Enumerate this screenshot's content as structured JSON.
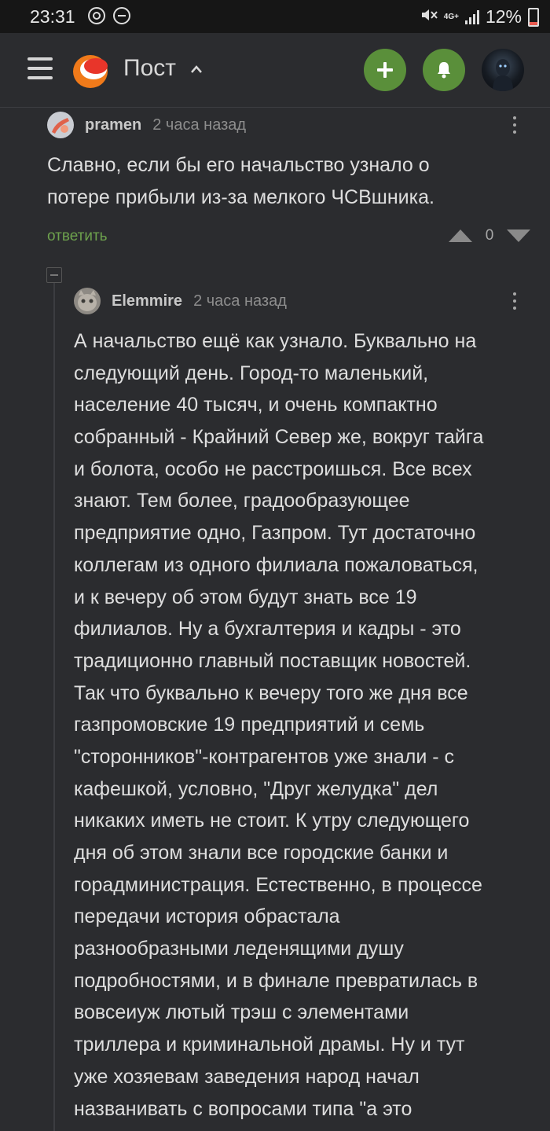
{
  "status_bar": {
    "time": "23:31",
    "network": "4G+",
    "battery": "12%"
  },
  "header": {
    "title": "Пост",
    "colors": {
      "accent_green": "#5a8f3a",
      "logo_orange": "#f07a1a"
    },
    "icons": [
      "menu-icon",
      "pikabu-logo",
      "chevron-up-icon",
      "plus-icon",
      "bell-icon",
      "user-avatar"
    ]
  },
  "comments": [
    {
      "user": "pramen",
      "time": "2 часа назад",
      "text_lines": [
        "Славно, если бы его начальство узнало о",
        "потере прибыли из-за мелкого ЧСВшника."
      ],
      "reply_label": "ответить",
      "rating": "0"
    },
    {
      "user": "Elemmire",
      "time": "2 часа назад",
      "text_lines": [
        "А начальство ещё как узнало. Буквально на",
        "следующий день. Город-то маленький,",
        "население 40 тысяч, и очень компактно",
        "собранный - Крайний Север же, вокруг тайга",
        "и болота, особо не расстроишься. Все всех",
        "знают. Тем более, градообразующее",
        "предприятие одно, Газпром. Тут достаточно",
        "коллегам из одного филиала пожаловаться,",
        "и к вечеру об этом будут знать все 19",
        "филиалов. Ну а бухгалтерия и кадры - это",
        "традиционно главный поставщик новостей.",
        "Так что буквально к вечеру того же дня все",
        "газпромовские 19 предприятий и семь",
        "\"сторонников\"-контрагентов уже знали - с",
        "кафешкой, условно, \"Друг желудка\" дел",
        "никаких иметь не стоит. К утру следующего",
        "дня об этом знали все городские банки и",
        "горадминистрация. Естественно, в процессе",
        "передачи история обрастала",
        "разнообразными леденящими душу",
        "подробностями, и в финале превратилась в",
        "вовсеиуж лютый трэш с элементами",
        "триллера и криминальной драмы. Ну и тут",
        "уже хозяевам заведения народ начал",
        "названивать с вопросами типа \"а это"
      ]
    }
  ]
}
